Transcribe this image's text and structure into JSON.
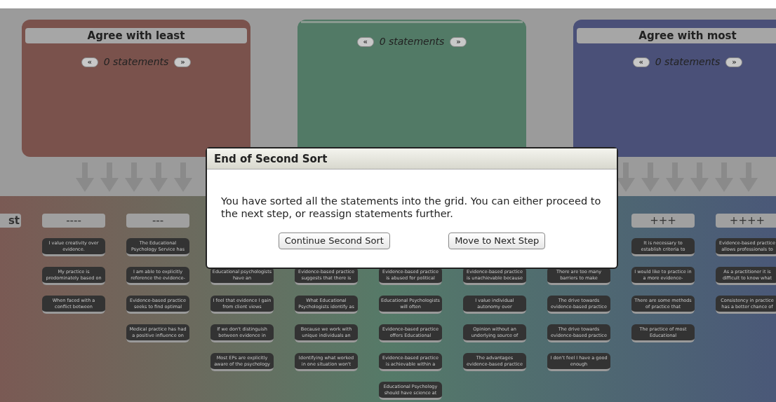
{
  "piles": [
    {
      "title": "Agree with least",
      "count": "0 statements",
      "prev": "«",
      "next": "»",
      "color": "#7a524c"
    },
    {
      "count": "0 statements",
      "prev": "«",
      "next": "»",
      "color": "#527a66"
    },
    {
      "title": "Agree with most",
      "count": "0 statements",
      "prev": "«",
      "next": "»",
      "color": "#4a5078"
    }
  ],
  "dialog": {
    "title": "End of Second Sort",
    "message": "You have sorted all the statements into the grid. You can either proceed to the next step, or reassign statements further.",
    "buttons": [
      "Continue Second Sort",
      "Move to Next Step"
    ]
  },
  "grid": {
    "columns": [
      {
        "header": "st"
      },
      {
        "header": "----",
        "cards": [
          "I value creativity over evidence.",
          "My practice is predominately based on",
          "When faced with a conflict between"
        ]
      },
      {
        "header": "---",
        "cards": [
          "The Educational Psychology Service has",
          "I am able to explicitly reference the evidence-",
          "Evidence-based practice seeks to find optimal",
          "Medical practice has had a positive influence on"
        ]
      },
      {
        "cards": [
          "Educational psychologists have an",
          "I feel that evidence I gain from client views",
          "If we don't distinguish between evidence in",
          "Most EPs are explicitly aware of the psychology"
        ]
      },
      {
        "cards": [
          "Evidence-based practice suggests that there is",
          "What Educational Psychologists identify as",
          "Because we work with unique individuals an",
          "Identifying what worked in one situation won't"
        ]
      },
      {
        "cards": [
          "Evidence-based practice is abused for political",
          "Educational Psychologists will often",
          "Evidence-based practice offers Educational",
          "Evidence-based practice is achievable within a",
          "Educational Psychology should have science at"
        ]
      },
      {
        "cards": [
          "Evidence-based practice is unachievable because",
          "I value individual autonomy over",
          "Opinion without an underlying source of",
          "The advantages evidence-based practice"
        ]
      },
      {
        "cards": [
          "There are too many barriers to make",
          "The drive towards evidence-based practice",
          "The drive towards evidence-based practice",
          "I don't feel I have a good enough"
        ]
      },
      {
        "header": "+++",
        "cards": [
          "It is necessary to establish criteria to",
          "I would like to practice in a more evidence-",
          "There are some methods of practice that",
          "The practice of most Educational"
        ]
      },
      {
        "header": "++++",
        "cards": [
          "Evidence-based practice allows professionals to",
          "As a practitioner it is difficult to know what",
          "Consistency in practice has a better chance of"
        ]
      }
    ]
  }
}
